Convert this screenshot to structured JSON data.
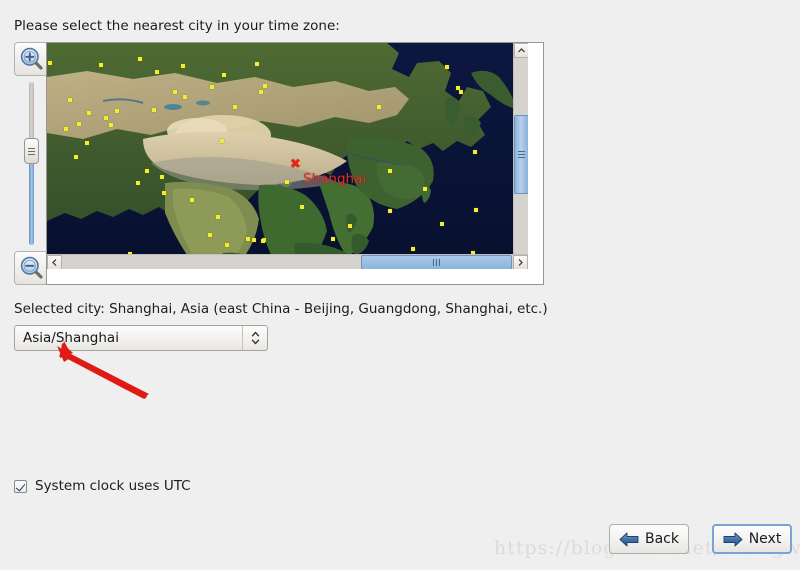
{
  "window": {
    "background_color": "#efefef"
  },
  "prompt": {
    "label": "Please select the nearest city in your time zone:"
  },
  "map_controls": {
    "zoom_in_label": "+",
    "zoom_out_label": "−",
    "zoom_in_icon": "magnifier-plus-icon",
    "zoom_out_icon": "magnifier-minus-icon",
    "slider_name": "zoom-slider"
  },
  "map": {
    "selected_marker_glyph": "✖",
    "selected_city_label": "Shanghai",
    "marker_color": "#ef2b22",
    "city_dot_color": "#f2ee2e",
    "ocean_color": "#0a1336",
    "scrollbar": {
      "up_glyph": "▲",
      "down_glyph": "▼",
      "left_glyph": "◀",
      "right_glyph": "▶"
    }
  },
  "selection": {
    "selected_city_text": "Selected city: Shanghai, Asia (east China - Beijing, Guangdong, Shanghai, etc.)",
    "timezone_value": "Asia/Shanghai",
    "timezone_placeholder": "Asia/Shanghai",
    "combo_up_glyph": "▴",
    "combo_down_glyph": "▾"
  },
  "options": {
    "utc_checkbox_label": "System clock uses UTC",
    "utc_checkbox_checked": true
  },
  "footer": {
    "back_label": "Back",
    "next_label": "Next",
    "back_icon": "arrow-left-icon",
    "next_icon": "arrow-right-icon"
  },
  "watermark": {
    "text": "https://blog.csdn.net/akangwu"
  },
  "annotation": {
    "arrow_color": "#e01b16",
    "arrow_name": "red-pointer-arrow"
  }
}
